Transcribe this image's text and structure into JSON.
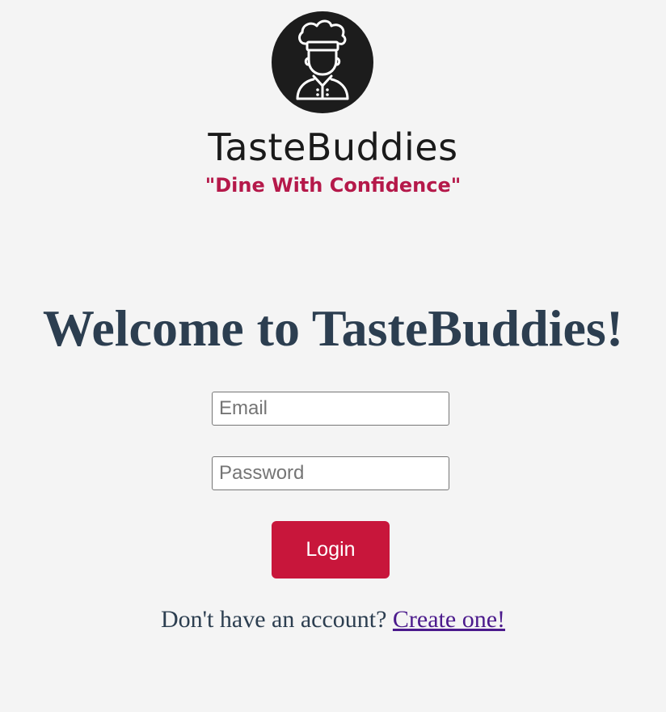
{
  "brand": {
    "logo_icon": "chef-icon",
    "name": "TasteBuddies",
    "tagline": "\"Dine With Confidence\""
  },
  "main": {
    "heading": "Welcome to TasteBuddies!",
    "email": {
      "value": "",
      "placeholder": "Email"
    },
    "password": {
      "value": "",
      "placeholder": "Password"
    },
    "login_label": "Login",
    "signup_prompt": "Don't have an account?",
    "signup_link": "Create one!"
  },
  "colors": {
    "background": "#f4f4f4",
    "heading": "#2c3e50",
    "tagline": "#b5194a",
    "button": "#c8163b",
    "link": "#4b1a8c",
    "logo_circle": "#1c1c1c"
  }
}
